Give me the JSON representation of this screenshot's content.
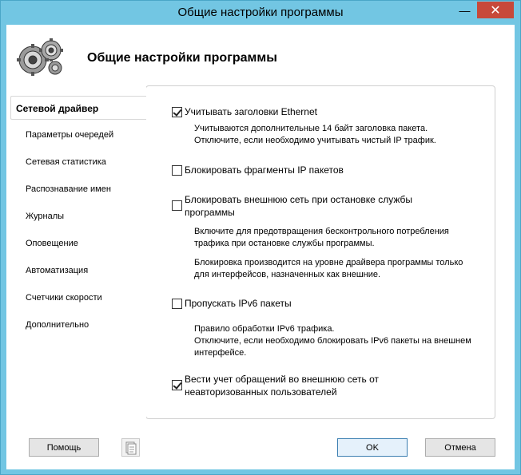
{
  "window": {
    "title": "Общие настройки программы",
    "minimize_glyph": "—",
    "close_glyph": "✕"
  },
  "header": {
    "title": "Общие настройки программы",
    "icon": "gears-icon"
  },
  "nav": {
    "items": [
      {
        "label": "Сетевой драйвер",
        "active": true
      },
      {
        "label": "Параметры очередей"
      },
      {
        "label": "Сетевая статистика"
      },
      {
        "label": "Распознавание имен"
      },
      {
        "label": "Журналы"
      },
      {
        "label": "Оповещение"
      },
      {
        "label": "Автоматизация"
      },
      {
        "label": "Счетчики скорости"
      },
      {
        "label": "Дополнительно"
      }
    ]
  },
  "settings": {
    "ethernet": {
      "label": "Учитывать заголовки Ethernet",
      "checked": true,
      "desc_line1": "Учитываются дополнительные 14 байт заголовка пакета.",
      "desc_line2": "Отключите, если необходимо учитывать чистый IP трафик."
    },
    "ip_fragments": {
      "label": "Блокировать фрагменты IP пакетов",
      "checked": false
    },
    "block_external": {
      "label_line1": "Блокировать внешнюю сеть при остановке службы",
      "label_line2": "программы",
      "checked": false,
      "desc_line1": "Включите для предотвращения бесконтрольного потребления",
      "desc_line2": "трафика при остановке службы программы.",
      "desc_line3": "Блокировка производится на уровне драйвера программы  только",
      "desc_line4": "для интерфейсов, назначенных как внешние."
    },
    "ipv6": {
      "label": "Пропускать IPv6 пакеты",
      "checked": false,
      "desc_line1": "Правило обработки IPv6 трафика.",
      "desc_line2": "Отключите, если необходимо блокировать IPv6 пакеты на внешнем",
      "desc_line3": "интерфейсе."
    },
    "log_unauthorized": {
      "label_line1": "Вести учет обращений во внешнюю сеть от",
      "label_line2": "неавторизованных пользователей",
      "checked": true
    }
  },
  "buttons": {
    "help": "Помощь",
    "ok": "OK",
    "cancel": "Отмена"
  }
}
